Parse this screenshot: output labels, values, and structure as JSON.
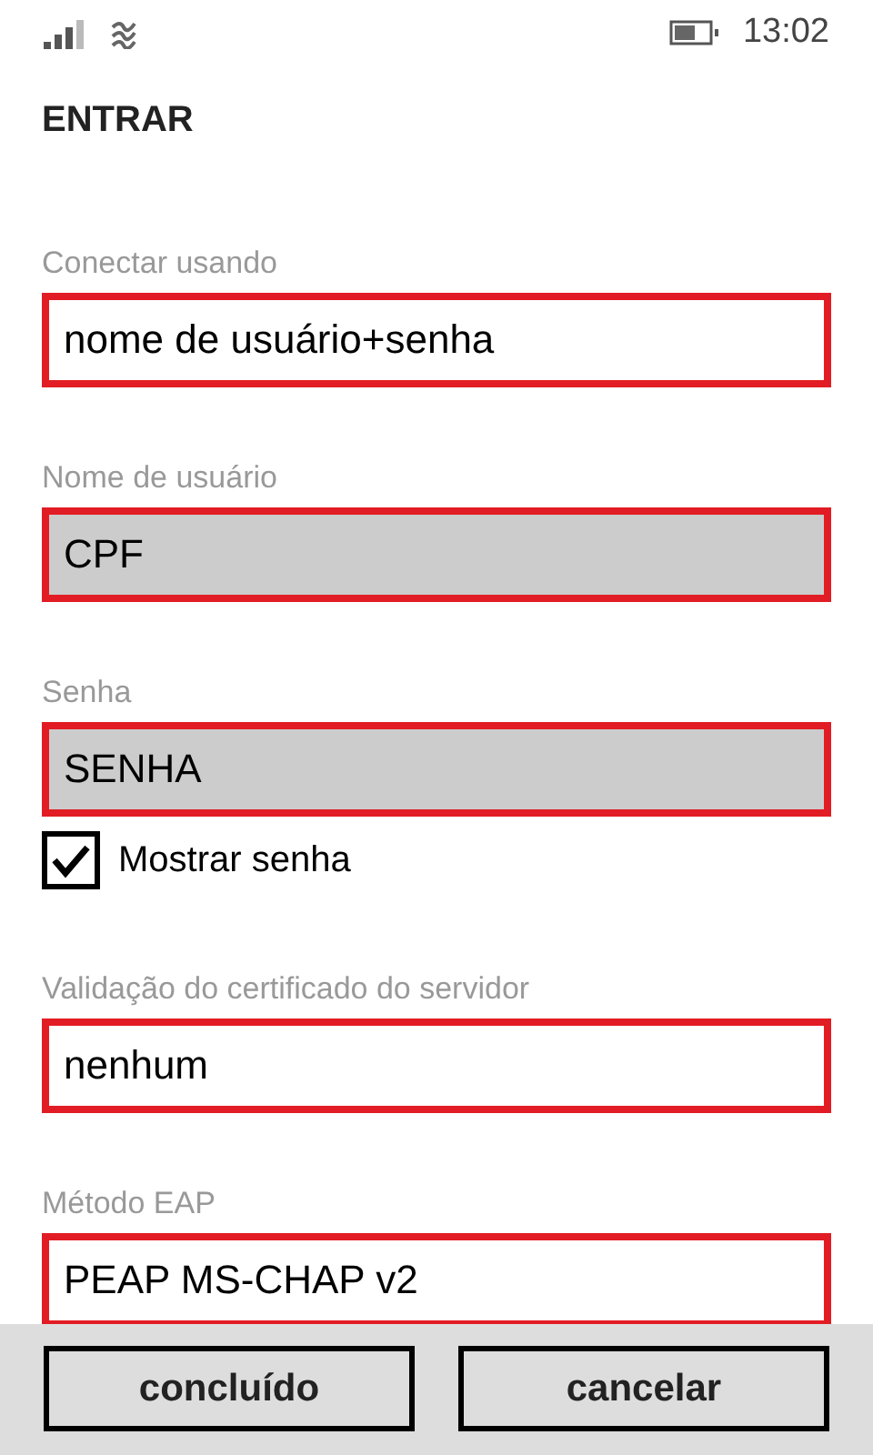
{
  "status_bar": {
    "time": "13:02"
  },
  "title": "ENTRAR",
  "items": [
    {
      "kind": "picker",
      "label": "Conectar usando",
      "value": "nome de usuário+senha",
      "highlighted": true
    },
    {
      "kind": "textbox",
      "label": "Nome de usuário",
      "value": "CPF",
      "highlighted": true
    },
    {
      "kind": "textbox",
      "label": "Senha",
      "value": "SENHA",
      "highlighted": true
    },
    {
      "kind": "checkbox",
      "label": "Mostrar senha",
      "checked": true
    },
    {
      "kind": "picker",
      "label": "Validação do certificado do servidor",
      "value": "nenhum",
      "highlighted": true
    },
    {
      "kind": "picker",
      "label": "Método EAP",
      "value": "PEAP MS-CHAP v2",
      "highlighted": true
    }
  ],
  "buttons": [
    "concluído",
    "cancelar"
  ]
}
